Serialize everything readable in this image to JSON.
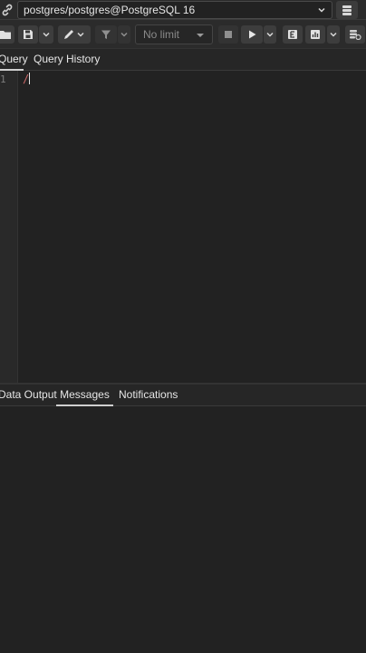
{
  "connection": {
    "label": "postgres/postgres@PostgreSQL 16",
    "link_icon": "link-icon",
    "db_icon": "database-stack-icon"
  },
  "toolbar": {
    "limit_value": "No limit",
    "icons": [
      "open-folder-icon",
      "save-icon",
      "chevron-down-icon",
      "edit-pen-icon",
      "filter-icon",
      "stop-icon",
      "play-icon",
      "explain-icon",
      "explain-analyze-icon",
      "macros-icon"
    ]
  },
  "editor_tabs": [
    {
      "label": "Query",
      "active": true
    },
    {
      "label": "Query History",
      "active": false
    }
  ],
  "editor": {
    "line_number": "1",
    "code": "/"
  },
  "results_tabs": [
    {
      "label": "Data Output",
      "active": false
    },
    {
      "label": "Messages",
      "active": true
    },
    {
      "label": "Notifications",
      "active": false
    }
  ],
  "colors": {
    "background": "#222222",
    "panel": "#2b2b2b",
    "button": "#3d3d3d",
    "text": "#e6e6e6",
    "code_red": "#d06b6b"
  }
}
